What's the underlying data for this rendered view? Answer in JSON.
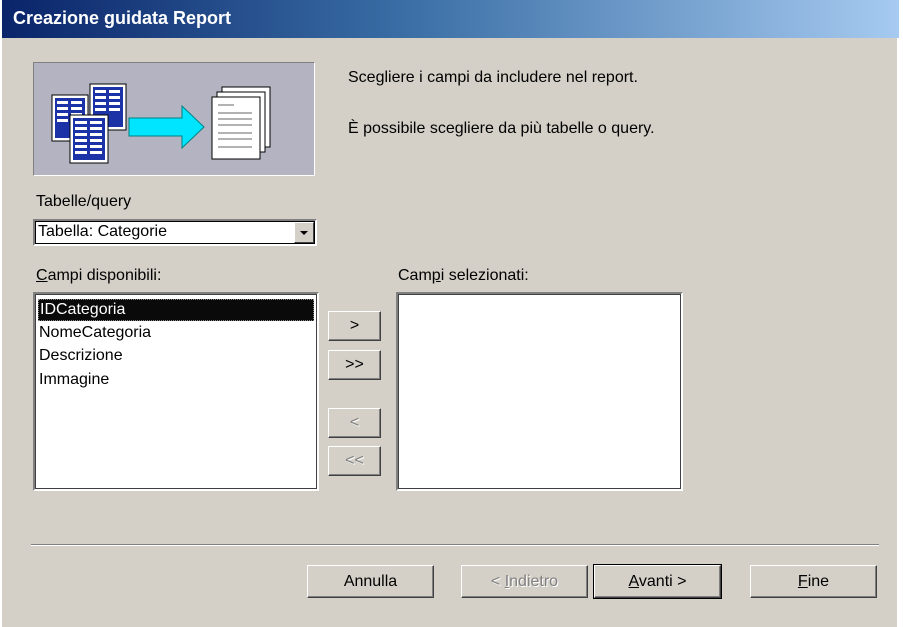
{
  "window": {
    "title": "Creazione guidata Report"
  },
  "instructions": {
    "line1": "Scegliere i campi da includere nel report.",
    "line2": "È possibile scegliere da più tabelle o query."
  },
  "tables": {
    "label": "Tabelle/query",
    "selected": "Tabella: Categorie"
  },
  "available": {
    "label_hotkey": "C",
    "label_rest": "ampi disponibili:",
    "items": [
      "IDCategoria",
      "NomeCategoria",
      "Descrizione",
      "Immagine"
    ]
  },
  "selected": {
    "label_pre": "Cam",
    "label_hotkey": "p",
    "label_post": "i selezionati:",
    "items": []
  },
  "move_buttons": {
    "add_one": ">",
    "add_all": ">>",
    "remove_one": "<",
    "remove_all": "<<"
  },
  "footer": {
    "cancel": "Annulla",
    "back_pre": "< ",
    "back_hotkey": "I",
    "back_post": "ndietro",
    "next_hotkey": "A",
    "next_post": "vanti >",
    "finish_hotkey": "F",
    "finish_post": "ine"
  },
  "icons": [
    "tables-to-report-icon",
    "dropdown-arrow-icon"
  ]
}
